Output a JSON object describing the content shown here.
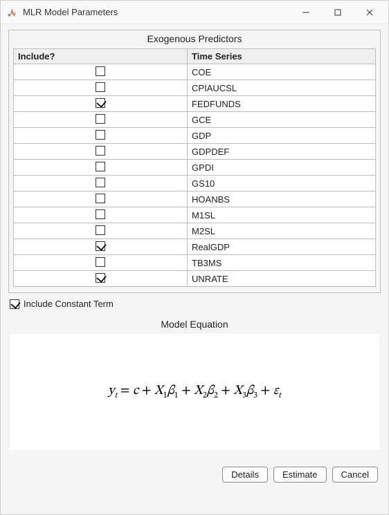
{
  "window": {
    "title": "MLR Model Parameters"
  },
  "group": {
    "title": "Exogenous Predictors"
  },
  "table": {
    "headers": {
      "include": "Include?",
      "series": "Time Series"
    },
    "rows": [
      {
        "series": "COE",
        "checked": false
      },
      {
        "series": "CPIAUCSL",
        "checked": false
      },
      {
        "series": "FEDFUNDS",
        "checked": true
      },
      {
        "series": "GCE",
        "checked": false
      },
      {
        "series": "GDP",
        "checked": false
      },
      {
        "series": "GDPDEF",
        "checked": false
      },
      {
        "series": "GPDI",
        "checked": false
      },
      {
        "series": "GS10",
        "checked": false
      },
      {
        "series": "HOANBS",
        "checked": false
      },
      {
        "series": "M1SL",
        "checked": false
      },
      {
        "series": "M2SL",
        "checked": false
      },
      {
        "series": "RealGDP",
        "checked": true
      },
      {
        "series": "TB3MS",
        "checked": false
      },
      {
        "series": "UNRATE",
        "checked": true
      }
    ]
  },
  "constantTerm": {
    "label": "Include Constant Term",
    "checked": true
  },
  "equation": {
    "title": "Model Equation",
    "text": "y_t = c + X_1 β_1 + X_2 β_2 + X_3 β_3 + ε_t"
  },
  "buttons": {
    "details": "Details",
    "estimate": "Estimate",
    "cancel": "Cancel"
  }
}
